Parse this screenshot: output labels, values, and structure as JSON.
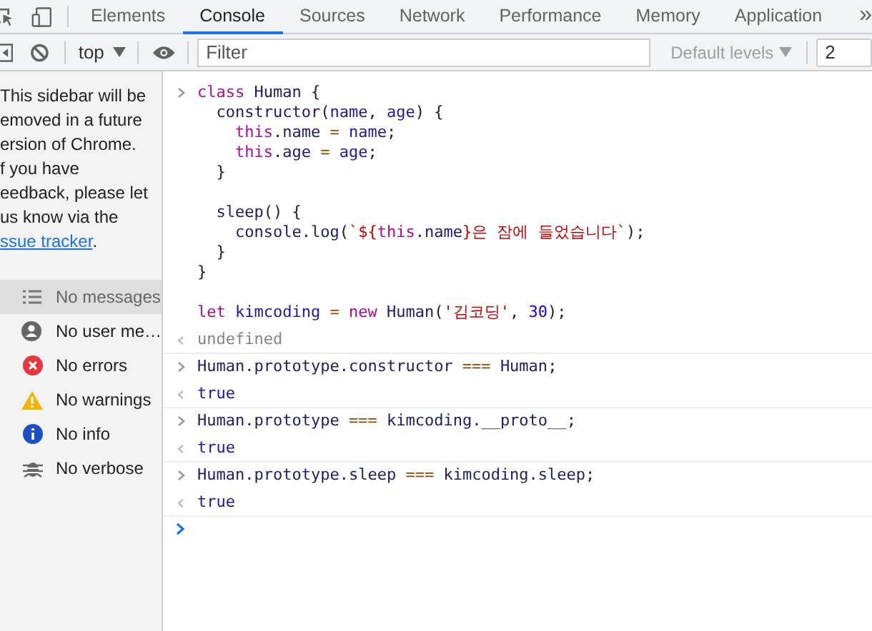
{
  "tabs": [
    {
      "label": "Elements",
      "selected": false
    },
    {
      "label": "Console",
      "selected": true
    },
    {
      "label": "Sources",
      "selected": false
    },
    {
      "label": "Network",
      "selected": false
    },
    {
      "label": "Performance",
      "selected": false
    },
    {
      "label": "Memory",
      "selected": false
    },
    {
      "label": "Application",
      "selected": false
    }
  ],
  "more_tabs": "»",
  "toolbar": {
    "context": "top",
    "filter": {
      "placeholder": "Filter"
    },
    "levels": "Default levels",
    "issues_count": "2"
  },
  "sidebar": {
    "notice": {
      "lines": [
        "This sidebar will be",
        "emoved in a future",
        "ersion of Chrome.",
        "f you have",
        "eedback, please let",
        "us know via the"
      ],
      "link": "ssue tracker",
      "end": "."
    },
    "filters": [
      {
        "label": "No messages",
        "kind": "messages",
        "selected": true
      },
      {
        "label": "No user me…",
        "kind": "user",
        "selected": false
      },
      {
        "label": "No errors",
        "kind": "errors",
        "selected": false
      },
      {
        "label": "No warnings",
        "kind": "warnings",
        "selected": false
      },
      {
        "label": "No info",
        "kind": "info",
        "selected": false
      },
      {
        "label": "No verbose",
        "kind": "verbose",
        "selected": false
      }
    ]
  },
  "console": {
    "entries": [
      {
        "input": [
          [
            [
              {
                "text": "class",
                "kind": "keyword"
              },
              {
                "text": " Human",
                "kind": "identifier"
              },
              {
                "text": " {",
                "kind": "plain"
              }
            ],
            [
              {
                "text": "  constructor",
                "kind": "identifier"
              },
              {
                "text": "(",
                "kind": "plain"
              },
              {
                "text": "name",
                "kind": "variable"
              },
              {
                "text": ", ",
                "kind": "plain"
              },
              {
                "text": "age",
                "kind": "variable"
              },
              {
                "text": ") {",
                "kind": "plain"
              }
            ],
            [
              {
                "text": "    this",
                "kind": "keyword"
              },
              {
                "text": ".",
                "kind": "plain"
              },
              {
                "text": "name",
                "kind": "identifier"
              },
              {
                "text": " = ",
                "kind": "operator"
              },
              {
                "text": "name",
                "kind": "variable"
              },
              {
                "text": ";",
                "kind": "plain"
              }
            ],
            [
              {
                "text": "    this",
                "kind": "keyword"
              },
              {
                "text": ".",
                "kind": "plain"
              },
              {
                "text": "age",
                "kind": "identifier"
              },
              {
                "text": " = ",
                "kind": "operator"
              },
              {
                "text": "age",
                "kind": "variable"
              },
              {
                "text": ";",
                "kind": "plain"
              }
            ],
            [
              {
                "text": "  }",
                "kind": "plain"
              }
            ]
          ],
          [
            [
              {
                "text": "  sleep",
                "kind": "identifier"
              },
              {
                "text": "() {",
                "kind": "plain"
              }
            ],
            [
              {
                "text": "    console",
                "kind": "identifier"
              },
              {
                "text": ".",
                "kind": "plain"
              },
              {
                "text": "log",
                "kind": "identifier"
              },
              {
                "text": "(",
                "kind": "plain"
              },
              {
                "text": "`${",
                "kind": "string"
              },
              {
                "text": "this",
                "kind": "keyword"
              },
              {
                "text": ".",
                "kind": "plain"
              },
              {
                "text": "name",
                "kind": "identifier"
              },
              {
                "text": "}은 잠에 들었습니다`",
                "kind": "string"
              },
              {
                "text": ");",
                "kind": "plain"
              }
            ],
            [
              {
                "text": "  }",
                "kind": "plain"
              }
            ],
            [
              {
                "text": "}",
                "kind": "plain"
              }
            ]
          ],
          [
            [
              {
                "text": "let",
                "kind": "keyword"
              },
              {
                "text": " kimcoding",
                "kind": "variable"
              },
              {
                "text": " = ",
                "kind": "operator"
              },
              {
                "text": "new",
                "kind": "keyword"
              },
              {
                "text": " Human",
                "kind": "identifier"
              },
              {
                "text": "(",
                "kind": "plain"
              },
              {
                "text": "'김코딩'",
                "kind": "string"
              },
              {
                "text": ", ",
                "kind": "plain"
              },
              {
                "text": "30",
                "kind": "number"
              },
              {
                "text": ");",
                "kind": "plain"
              }
            ]
          ]
        ],
        "output": {
          "text": "undefined",
          "kind": "undefined"
        }
      },
      {
        "input": [
          [
            [
              {
                "text": "Human.prototype.constructor",
                "kind": "identifier"
              },
              {
                "text": " === ",
                "kind": "operator"
              },
              {
                "text": "Human",
                "kind": "identifier"
              },
              {
                "text": ";",
                "kind": "plain"
              }
            ]
          ]
        ],
        "output": {
          "text": "true",
          "kind": "boolean"
        }
      },
      {
        "input": [
          [
            [
              {
                "text": "Human.prototype",
                "kind": "identifier"
              },
              {
                "text": " === ",
                "kind": "operator"
              },
              {
                "text": "kimcoding.__proto__",
                "kind": "identifier"
              },
              {
                "text": ";",
                "kind": "plain"
              }
            ]
          ]
        ],
        "output": {
          "text": "true",
          "kind": "boolean"
        }
      },
      {
        "input": [
          [
            [
              {
                "text": "Human.prototype.sleep",
                "kind": "identifier"
              },
              {
                "text": " === ",
                "kind": "operator"
              },
              {
                "text": "kimcoding.sleep",
                "kind": "identifier"
              },
              {
                "text": ";",
                "kind": "plain"
              }
            ]
          ]
        ],
        "output": {
          "text": "true",
          "kind": "boolean"
        }
      }
    ]
  }
}
